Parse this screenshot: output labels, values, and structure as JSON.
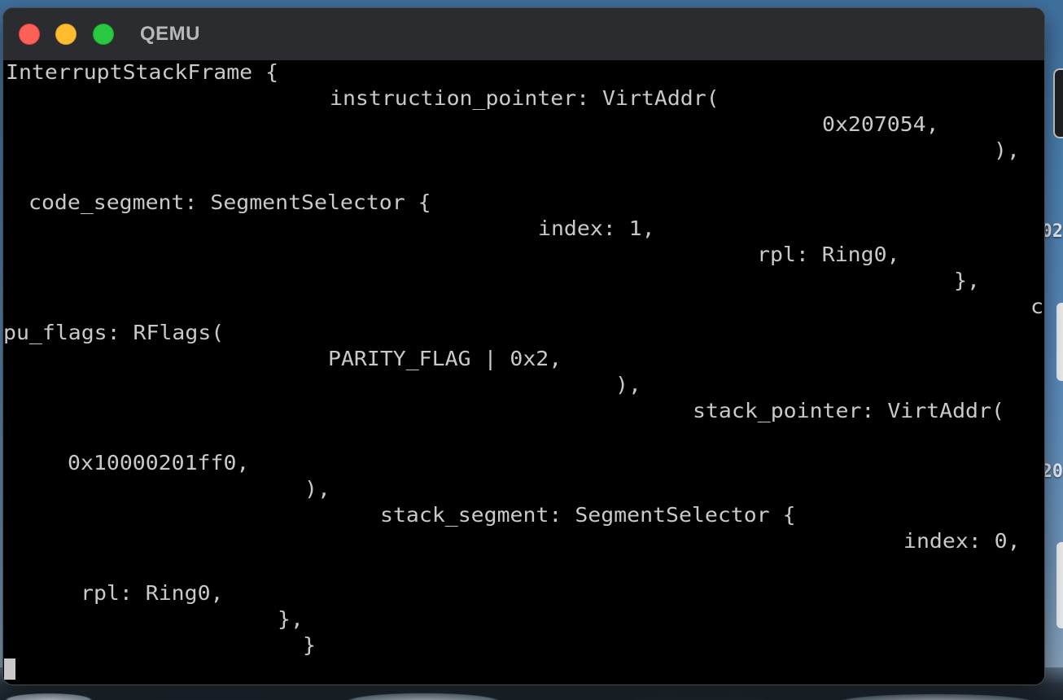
{
  "window": {
    "title": "QEMU"
  },
  "console": {
    "lines": [
      "InterruptStackFrame {",
      "instruction_pointer: VirtAddr(",
      "0x207054,",
      "),",
      "code_segment: SegmentSelector {",
      "index: 1,",
      "rpl: Ring0,",
      "},",
      "c",
      "pu_flags: RFlags(",
      "PARITY_FLAG | 0x2,",
      "),",
      "stack_pointer: VirtAddr(",
      "0x10000201ff0,",
      "),",
      "stack_segment: SegmentSelector {",
      "index: 0,",
      "rpl: Ring0,",
      "},",
      "}"
    ]
  },
  "desktop": {
    "peek_texts": [
      "02",
      "20"
    ]
  }
}
